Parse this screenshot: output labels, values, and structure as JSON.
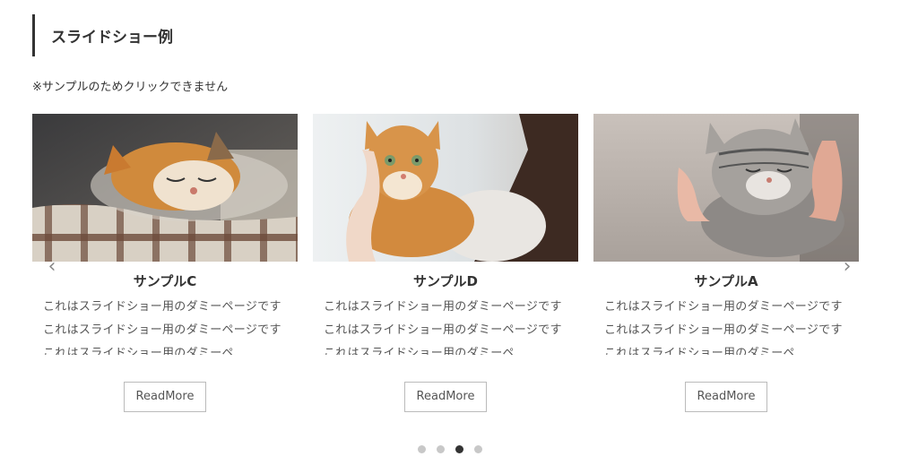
{
  "section": {
    "heading": "スライドショー例",
    "note": "※サンプルのためクリックできません"
  },
  "slides": [
    {
      "title": "サンプルC",
      "excerpt": "これはスライドショー用のダミーページです これはスライドショー用のダミーページです これはスライドショー用のダミーペ",
      "button": "ReadMore",
      "image": "sleeping-ginger-tabby-cat-on-plaid-blanket"
    },
    {
      "title": "サンプルD",
      "excerpt": "これはスライドショー用のダミーページです これはスライドショー用のダミーページです これはスライドショー用のダミーペ",
      "button": "ReadMore",
      "image": "orange-tabby-cat-held-by-person"
    },
    {
      "title": "サンプルA",
      "excerpt": "これはスライドショー用のダミーページです これはスライドショー用のダミーページです これはスライドショー用のダミーペ",
      "button": "ReadMore",
      "image": "gray-tabby-cat-being-petted-by-hands"
    }
  ],
  "navigation": {
    "prev_icon": "chevron-left-icon",
    "next_icon": "chevron-right-icon",
    "dots_total": 4,
    "active_dot": 3
  },
  "colors": {
    "text": "#333333",
    "dot_inactive": "#c8c8c8",
    "dot_active": "#333333"
  }
}
